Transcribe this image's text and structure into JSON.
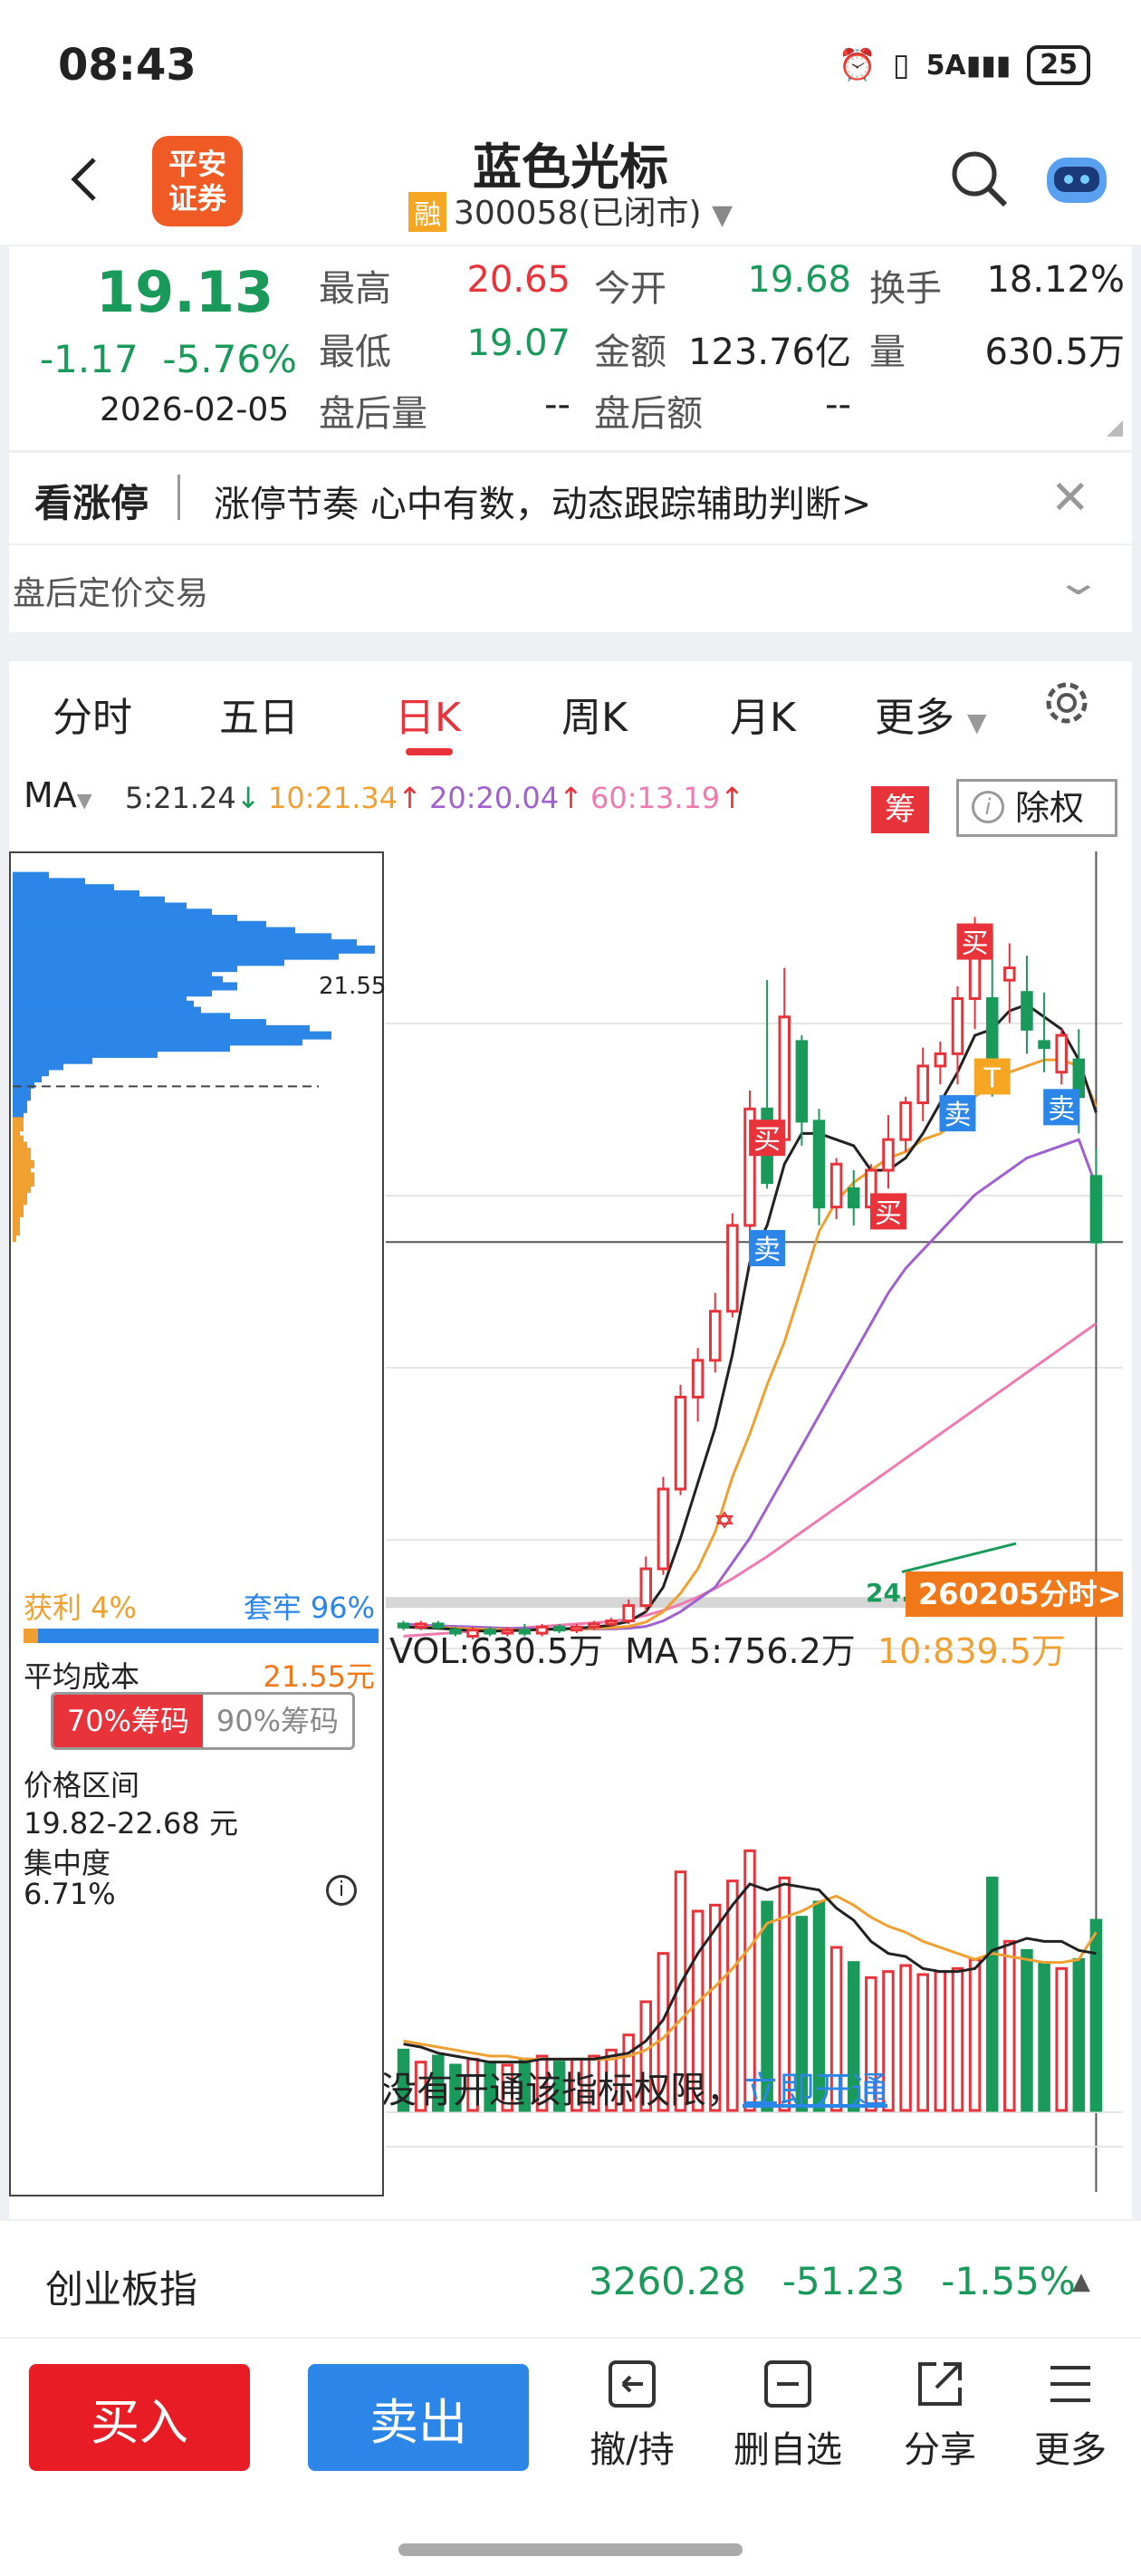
{
  "status": {
    "time": "08:43",
    "battery": "25"
  },
  "header": {
    "logo_line1": "平安",
    "logo_line2": "证券",
    "stock_name": "蓝色光标",
    "rong": "融",
    "stock_code": "300058(已闭市)"
  },
  "quote": {
    "price": "19.13",
    "change": "-1.17",
    "change_pct": "-5.76%",
    "date": "2026-02-05",
    "high_label": "最高",
    "high": "20.65",
    "open_label": "今开",
    "open": "19.68",
    "turnover_label": "换手",
    "turnover": "18.12%",
    "low_label": "最低",
    "low": "19.07",
    "amount_label": "金额",
    "amount": "123.76亿",
    "volume_label": "量",
    "volume": "630.5万",
    "ah_vol_label": "盘后量",
    "ah_vol": "--",
    "ah_amt_label": "盘后额",
    "ah_amt": "--"
  },
  "promo": {
    "title": "看涨停",
    "text": "涨停节奏 心中有数，动态跟踪辅助判断>"
  },
  "afterhours": {
    "label": "盘后定价交易"
  },
  "tabs": [
    "分时",
    "五日",
    "日K",
    "周K",
    "月K",
    "更多"
  ],
  "active_tab": "日K",
  "ma": {
    "label": "MA",
    "ma5": "5:21.24",
    "ma10": "10:21.34",
    "ma20": "20:20.04",
    "ma60": "60:13.19",
    "chou": "筹",
    "chuquan": "除权"
  },
  "kline": {
    "high_marker": "24.43",
    "chip_price_marker": "21.55",
    "markers": {
      "buy": "买",
      "sell": "卖",
      "t": "T"
    },
    "minute_button": "260205分时>",
    "volume_label": "VOL:630.5万",
    "vol_ma5": "MA 5:756.2万",
    "vol_ma10": "10:839.5万",
    "permission_text": "没有开通该指标权限，",
    "permission_link": "立即开通"
  },
  "chip": {
    "profit_label": "获利 4%",
    "locked_label": "套牢 96%",
    "profit_ratio": 0.04,
    "avg_cost_label": "平均成本",
    "avg_cost": "21.55元",
    "tab70": "70%筹码",
    "tab90": "90%筹码",
    "range_label": "价格区间",
    "range": "19.82-22.68 元",
    "conc_label": "集中度",
    "conc": "6.71%"
  },
  "index": {
    "name": "创业板指",
    "value": "3260.28",
    "change": "-51.23",
    "pct": "-1.55%"
  },
  "actions": {
    "buy": "买入",
    "sell": "卖出",
    "revoke": "撤/持",
    "remove": "删自选",
    "share": "分享",
    "more": "更多"
  },
  "colors": {
    "up": "#e8333a",
    "down": "#1a9a5a",
    "accent_blue": "#2b86e8",
    "ma5": "#222222",
    "ma10": "#f0a030",
    "ma20": "#a060d0",
    "ma60": "#f07ab0"
  },
  "chart_data": {
    "type": "candlestick",
    "ylim": [
      12.5,
      25.5
    ],
    "candles": [
      [
        12.9,
        12.85,
        12.95,
        12.8
      ],
      [
        12.85,
        12.9,
        12.95,
        12.8
      ],
      [
        12.9,
        12.85,
        12.95,
        12.8
      ],
      [
        12.8,
        12.75,
        12.85,
        12.7
      ],
      [
        12.7,
        12.8,
        12.85,
        12.65
      ],
      [
        12.8,
        12.75,
        12.85,
        12.7
      ],
      [
        12.75,
        12.8,
        12.85,
        12.7
      ],
      [
        12.8,
        12.75,
        12.9,
        12.7
      ],
      [
        12.75,
        12.85,
        12.9,
        12.7
      ],
      [
        12.85,
        12.8,
        12.9,
        12.75
      ],
      [
        12.8,
        12.85,
        12.9,
        12.75
      ],
      [
        12.85,
        12.9,
        12.95,
        12.8
      ],
      [
        12.9,
        12.95,
        13.0,
        12.85
      ],
      [
        12.95,
        13.2,
        13.3,
        12.9
      ],
      [
        13.2,
        13.8,
        14.0,
        13.1
      ],
      [
        13.8,
        15.1,
        15.3,
        13.7
      ],
      [
        15.1,
        16.6,
        16.8,
        15.0
      ],
      [
        16.6,
        17.2,
        17.4,
        16.2
      ],
      [
        17.2,
        18.0,
        18.3,
        17.0
      ],
      [
        18.0,
        19.4,
        19.6,
        17.9
      ],
      [
        19.4,
        21.3,
        21.6,
        19.0
      ],
      [
        21.3,
        20.1,
        23.4,
        20.0
      ],
      [
        20.8,
        22.8,
        23.6,
        20.6
      ],
      [
        22.4,
        21.1,
        22.5,
        20.7
      ],
      [
        21.1,
        19.7,
        21.3,
        19.4
      ],
      [
        19.7,
        20.4,
        20.5,
        19.5
      ],
      [
        20.0,
        19.7,
        20.3,
        19.4
      ],
      [
        19.7,
        20.3,
        20.4,
        19.6
      ],
      [
        20.3,
        20.8,
        21.2,
        20.0
      ],
      [
        20.8,
        21.4,
        21.5,
        20.6
      ],
      [
        21.4,
        22.0,
        22.3,
        21.1
      ],
      [
        22.0,
        22.2,
        22.4,
        21.7
      ],
      [
        22.2,
        23.1,
        23.3,
        21.7
      ],
      [
        23.1,
        24.0,
        24.43,
        22.6
      ],
      [
        23.1,
        21.7,
        24.2,
        21.5
      ],
      [
        23.4,
        23.6,
        24.0,
        22.7
      ],
      [
        23.2,
        22.6,
        23.8,
        22.2
      ],
      [
        22.4,
        22.3,
        23.2,
        21.9
      ],
      [
        21.9,
        22.5,
        22.6,
        21.7
      ],
      [
        22.1,
        21.5,
        22.6,
        20.9
      ],
      [
        20.2,
        19.13,
        20.65,
        19.07
      ]
    ],
    "ma5": [
      12.85,
      12.84,
      12.83,
      12.81,
      12.79,
      12.78,
      12.79,
      12.8,
      12.81,
      12.82,
      12.83,
      12.85,
      12.88,
      12.94,
      13.1,
      13.5,
      14.3,
      15.2,
      16.1,
      17.3,
      18.8,
      19.4,
      20.4,
      20.9,
      20.9,
      20.8,
      20.7,
      20.3,
      20.3,
      20.5,
      20.9,
      21.4,
      21.9,
      22.5,
      22.6,
      22.9,
      23.0,
      22.8,
      22.6,
      22.1,
      21.24
    ],
    "ma10": [
      12.85,
      12.85,
      12.84,
      12.83,
      12.82,
      12.81,
      12.81,
      12.8,
      12.81,
      12.82,
      12.82,
      12.83,
      12.84,
      12.86,
      12.93,
      13.1,
      13.4,
      13.8,
      14.4,
      15.3,
      16.0,
      16.8,
      17.5,
      18.4,
      19.3,
      19.8,
      20.1,
      20.3,
      20.5,
      20.6,
      20.8,
      20.9,
      21.1,
      21.5,
      21.7,
      21.9,
      22.0,
      22.1,
      22.1,
      22.0,
      21.34
    ],
    "ma20": [
      12.9,
      12.88,
      12.87,
      12.86,
      12.85,
      12.84,
      12.83,
      12.83,
      12.82,
      12.82,
      12.82,
      12.82,
      12.82,
      12.83,
      12.86,
      12.95,
      13.1,
      13.3,
      13.5,
      13.9,
      14.3,
      14.8,
      15.3,
      15.8,
      16.3,
      16.8,
      17.3,
      17.8,
      18.3,
      18.7,
      19.0,
      19.3,
      19.6,
      19.9,
      20.1,
      20.3,
      20.5,
      20.6,
      20.7,
      20.8,
      20.04
    ],
    "ma60": [
      12.7,
      12.72,
      12.74,
      12.76,
      12.78,
      12.8,
      12.82,
      12.84,
      12.86,
      12.88,
      12.9,
      12.92,
      12.94,
      12.98,
      13.04,
      13.12,
      13.22,
      13.34,
      13.48,
      13.64,
      13.82,
      14.0,
      14.2,
      14.4,
      14.6,
      14.8,
      15.0,
      15.2,
      15.4,
      15.6,
      15.8,
      16.0,
      16.2,
      16.4,
      16.6,
      16.8,
      17.0,
      17.2,
      17.4,
      17.6,
      17.8
    ],
    "volume": [
      2.0,
      1.6,
      1.8,
      1.5,
      1.7,
      1.6,
      1.5,
      1.7,
      1.8,
      1.6,
      1.7,
      1.8,
      2.0,
      2.5,
      3.6,
      5.2,
      7.9,
      6.6,
      6.8,
      7.6,
      8.6,
      6.9,
      7.7,
      6.4,
      6.9,
      5.4,
      4.9,
      4.4,
      4.6,
      4.8,
      4.5,
      4.6,
      4.7,
      5.0,
      7.7,
      5.6,
      5.3,
      4.9,
      4.7,
      5.0,
      6.3
    ],
    "vol_ma5": [
      2.2,
      2.1,
      1.9,
      1.8,
      1.7,
      1.6,
      1.6,
      1.6,
      1.7,
      1.7,
      1.7,
      1.7,
      1.8,
      1.9,
      2.3,
      3.0,
      4.2,
      5.2,
      6.0,
      6.8,
      7.5,
      7.3,
      7.5,
      7.4,
      7.3,
      6.7,
      6.3,
      5.6,
      5.2,
      5.1,
      4.7,
      4.6,
      4.6,
      4.7,
      5.3,
      5.5,
      5.7,
      5.6,
      5.6,
      5.3,
      5.2
    ],
    "vol_ma10": [
      2.3,
      2.2,
      2.1,
      2.0,
      1.9,
      1.8,
      1.8,
      1.7,
      1.7,
      1.7,
      1.7,
      1.7,
      1.7,
      1.8,
      2.0,
      2.4,
      3.0,
      3.6,
      4.1,
      4.7,
      5.4,
      6.2,
      6.4,
      6.6,
      6.9,
      7.1,
      6.8,
      6.4,
      6.1,
      5.9,
      5.6,
      5.4,
      5.2,
      5.0,
      5.2,
      5.1,
      5.0,
      4.9,
      4.9,
      5.0,
      5.9
    ],
    "chip_bins": [
      [
        24.9,
        0.1
      ],
      [
        24.8,
        0.2
      ],
      [
        24.7,
        0.28
      ],
      [
        24.6,
        0.35
      ],
      [
        24.5,
        0.42
      ],
      [
        24.4,
        0.48
      ],
      [
        24.3,
        0.55
      ],
      [
        24.2,
        0.62
      ],
      [
        24.1,
        0.7
      ],
      [
        24.0,
        0.78
      ],
      [
        23.9,
        0.88
      ],
      [
        23.8,
        0.95
      ],
      [
        23.7,
        1.0
      ],
      [
        23.6,
        0.9
      ],
      [
        23.5,
        0.75
      ],
      [
        23.4,
        0.62
      ],
      [
        23.3,
        0.55
      ],
      [
        23.2,
        0.58
      ],
      [
        23.1,
        0.62
      ],
      [
        23.0,
        0.55
      ],
      [
        22.9,
        0.48
      ],
      [
        22.8,
        0.5
      ],
      [
        22.7,
        0.52
      ],
      [
        22.6,
        0.6
      ],
      [
        22.5,
        0.7
      ],
      [
        22.4,
        0.82
      ],
      [
        22.3,
        0.88
      ],
      [
        22.2,
        0.8
      ],
      [
        22.1,
        0.6
      ],
      [
        22.0,
        0.4
      ],
      [
        21.9,
        0.22
      ],
      [
        21.8,
        0.14
      ],
      [
        21.7,
        0.1
      ],
      [
        21.6,
        0.08
      ],
      [
        21.5,
        0.06
      ],
      [
        21.4,
        0.05
      ],
      [
        21.3,
        0.05
      ],
      [
        21.2,
        0.04
      ],
      [
        21.1,
        0.04
      ],
      [
        21.0,
        0.03
      ],
      [
        20.9,
        0.03
      ],
      [
        20.8,
        0.03
      ],
      [
        20.7,
        0.02
      ],
      [
        20.6,
        0.03
      ],
      [
        20.5,
        0.04
      ],
      [
        20.4,
        0.05
      ],
      [
        20.3,
        0.05
      ],
      [
        20.2,
        0.06
      ],
      [
        20.1,
        0.05
      ],
      [
        20.0,
        0.06
      ],
      [
        19.9,
        0.06
      ],
      [
        19.8,
        0.05
      ],
      [
        19.7,
        0.04
      ],
      [
        19.6,
        0.04
      ],
      [
        19.5,
        0.03
      ],
      [
        19.4,
        0.03
      ],
      [
        19.3,
        0.02
      ],
      [
        19.2,
        0.02
      ],
      [
        19.1,
        0.02
      ],
      [
        19.0,
        0.01
      ]
    ]
  }
}
